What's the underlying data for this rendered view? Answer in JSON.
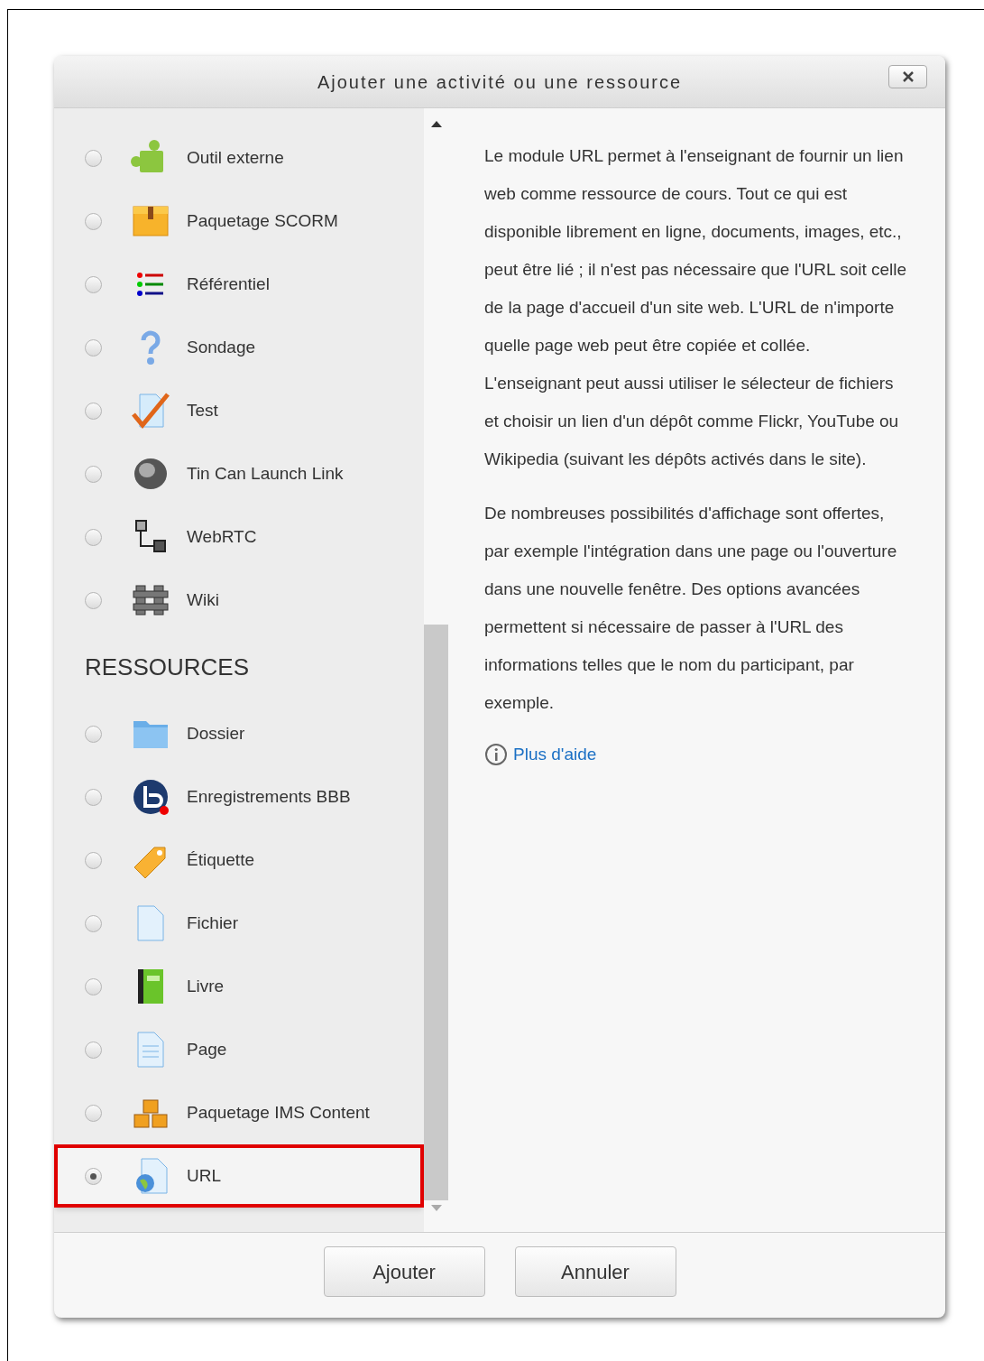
{
  "dialog": {
    "title": "Ajouter une activité ou une ressource"
  },
  "activities": [
    {
      "label": "Outil externe",
      "selected": false
    },
    {
      "label": "Paquetage SCORM",
      "selected": false
    },
    {
      "label": "Référentiel",
      "selected": false
    },
    {
      "label": "Sondage",
      "selected": false
    },
    {
      "label": "Test",
      "selected": false
    },
    {
      "label": "Tin Can Launch Link",
      "selected": false
    },
    {
      "label": "WebRTC",
      "selected": false
    },
    {
      "label": "Wiki",
      "selected": false
    }
  ],
  "resources_heading": "RESSOURCES",
  "resources": [
    {
      "label": "Dossier",
      "selected": false
    },
    {
      "label": "Enregistrements BBB",
      "selected": false
    },
    {
      "label": "Étiquette",
      "selected": false
    },
    {
      "label": "Fichier",
      "selected": false
    },
    {
      "label": "Livre",
      "selected": false
    },
    {
      "label": "Page",
      "selected": false
    },
    {
      "label": "Paquetage IMS Content",
      "selected": false
    },
    {
      "label": "URL",
      "selected": true
    }
  ],
  "description": [
    "Le module URL permet à l'enseignant de fournir un lien web comme ressource de cours. Tout ce qui est disponible librement en ligne, documents, images, etc., peut être lié ; il n'est pas nécessaire que l'URL soit celle de la page d'accueil d'un site web. L'URL de n'importe quelle page web peut être copiée et collée. L'enseignant peut aussi utiliser le sélecteur de fichiers et choisir un lien d'un dépôt comme Flickr, YouTube ou Wikipedia (suivant les dépôts activés dans le site).",
    "De nombreuses possibilités d'affichage sont offertes, par exemple l'intégration dans une page ou l'ouverture dans une nouvelle fenêtre. Des options avancées permettent si nécessaire de passer à l'URL des informations telles que le nom du participant, par exemple."
  ],
  "help_link": "Plus d'aide",
  "buttons": [
    "Ajouter",
    "Annuler"
  ]
}
